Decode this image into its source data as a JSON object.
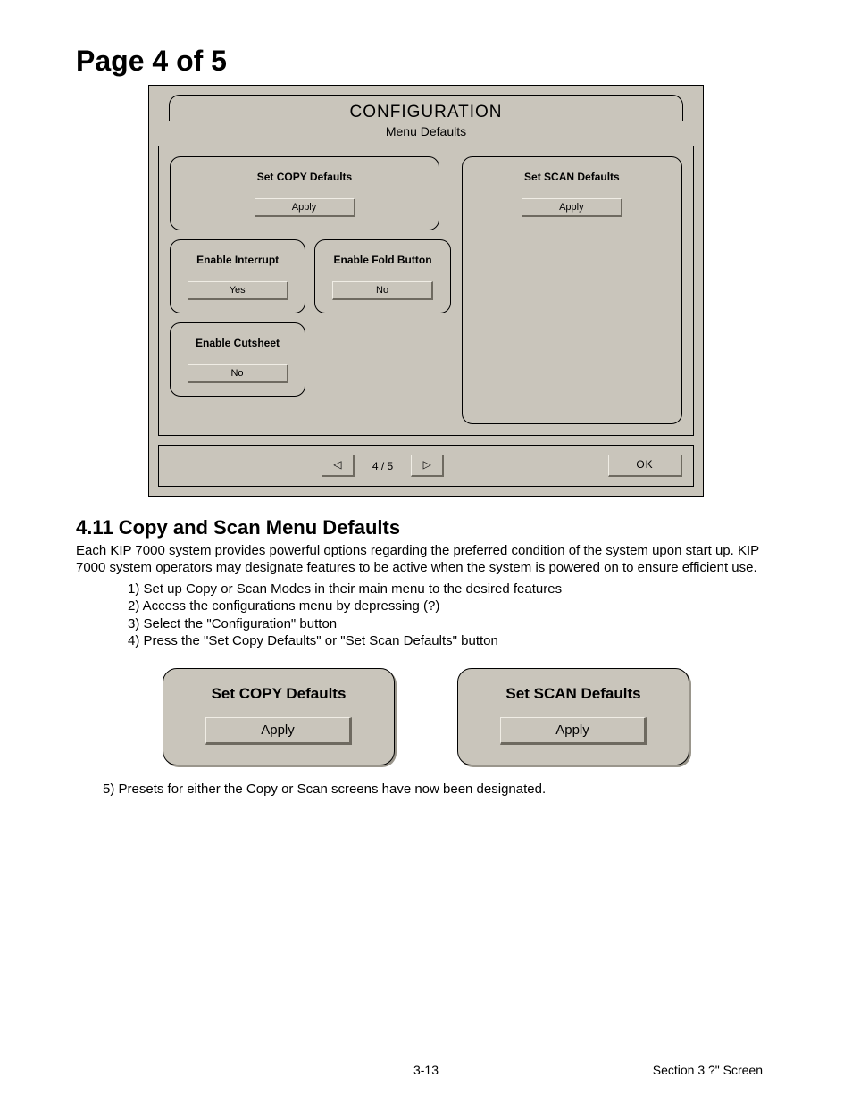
{
  "heading": "Page 4 of 5",
  "panel": {
    "title": "CONFIGURATION",
    "subtitle": "Menu Defaults",
    "options": {
      "copyDefaults": {
        "title": "Set COPY Defaults",
        "button": "Apply"
      },
      "scanDefaults": {
        "title": "Set SCAN Defaults",
        "button": "Apply"
      },
      "enableInterrupt": {
        "title": "Enable Interrupt",
        "button": "Yes"
      },
      "enableFold": {
        "title": "Enable Fold Button",
        "button": "No"
      },
      "enableCutsheet": {
        "title": "Enable Cutsheet",
        "button": "No"
      }
    },
    "footer": {
      "prev": "◁",
      "page": "4 / 5",
      "next": "▷",
      "ok": "OK"
    }
  },
  "section": {
    "title": "4.11 Copy and Scan Menu Defaults",
    "intro": "Each KIP 7000 system provides powerful options regarding the preferred condition of the system upon start up.  KIP 7000 system operators may designate features to be active when the system is powered on to ensure efficient use.",
    "steps": {
      "s1": "1)  Set up Copy or Scan Modes in their main menu to the desired features",
      "s2": "2)  Access the configurations menu by depressing (?)",
      "s3": "3)  Select the \"Configuration\" button",
      "s4": "4)  Press the \"Set Copy Defaults\" or \"Set Scan Defaults\" button"
    },
    "step5": "5)  Presets for either the Copy or Scan screens have now been designated."
  },
  "closeups": {
    "copy": {
      "title": "Set COPY Defaults",
      "button": "Apply"
    },
    "scan": {
      "title": "Set SCAN Defaults",
      "button": "Apply"
    }
  },
  "docFooter": {
    "pageNum": "3-13",
    "section": "Section 3     ?\" Screen"
  }
}
